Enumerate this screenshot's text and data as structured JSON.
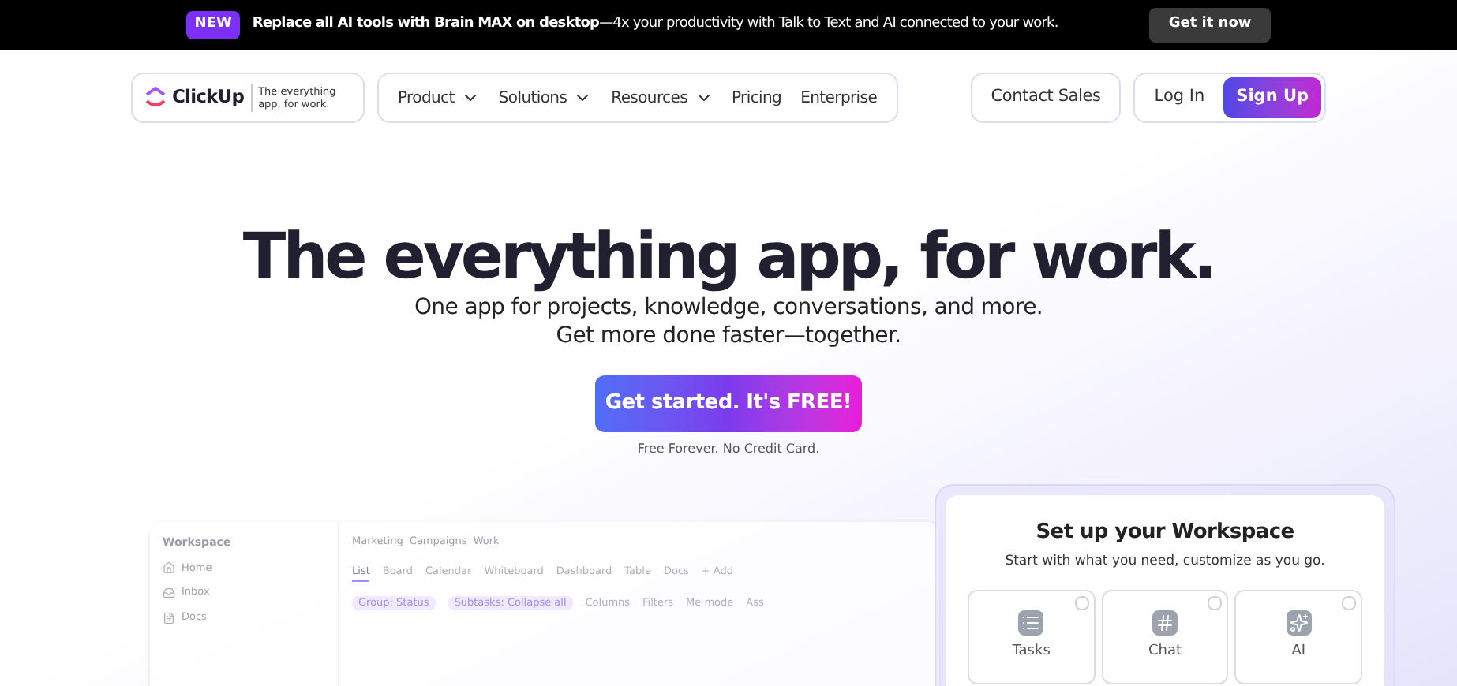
{
  "promo": {
    "badge": "NEW",
    "text": "**Replace all AI tools with Brain MAX on desktop**—4x your productivity with Talk to Text and AI connected to your work.",
    "button": "Get it now"
  },
  "nav": {
    "logo": "ClickUp",
    "tagline": "The everything app, for work.",
    "items": [
      {
        "label": "Product",
        "dropdown": true
      },
      {
        "label": "Solutions",
        "dropdown": true
      },
      {
        "label": "Resources",
        "dropdown": true
      },
      {
        "label": "Pricing",
        "dropdown": false
      },
      {
        "label": "Enterprise",
        "dropdown": false
      }
    ],
    "contact": "Contact Sales",
    "login": "Log In",
    "signup": "Sign Up"
  },
  "hero": {
    "title": "The everything app, for work.",
    "subtitle": [
      "One app for projects, knowledge, conversations, and more.",
      "Get more done faster—together."
    ],
    "cta": "Get started. It's FREE!",
    "note": "Free Forever. No Credit Card."
  },
  "preview": {
    "workspace": "Workspace",
    "sidebar": [
      "Home",
      "Inbox",
      "Docs"
    ],
    "breadcrumb": [
      "Marketing",
      "Campaigns",
      "Work"
    ],
    "views": [
      {
        "label": "List",
        "selected": true
      },
      {
        "label": "Board",
        "selected": false
      },
      {
        "label": "Calendar",
        "selected": false
      },
      {
        "label": "Whiteboard",
        "selected": false
      },
      {
        "label": "Dashboard",
        "selected": false
      },
      {
        "label": "Table",
        "selected": false
      },
      {
        "label": "Docs",
        "selected": false
      },
      {
        "label": "+ Add",
        "selected": false
      }
    ],
    "chips": [
      "Group: Status",
      "Subtasks: Collapse all"
    ],
    "tools": [
      "Columns",
      "Filters",
      "Me mode",
      "Ass"
    ]
  },
  "setup": {
    "title": "Set up your Workspace",
    "subtitle": "Start with what you need, customize as you go.",
    "options": [
      {
        "label": "Tasks",
        "kind": "tasks",
        "checked": false
      },
      {
        "label": "Chat",
        "kind": "chat",
        "checked": false
      },
      {
        "label": "AI",
        "kind": "ai",
        "checked": false
      }
    ]
  }
}
